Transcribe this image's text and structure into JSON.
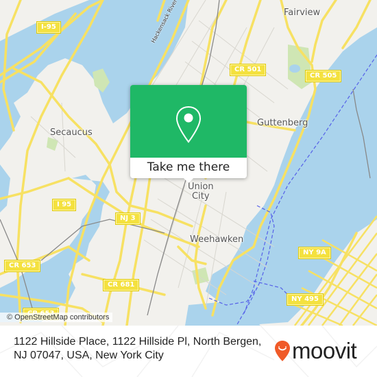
{
  "map": {
    "place_labels": [
      {
        "id": "fairview",
        "text": "Fairview"
      },
      {
        "id": "secaucus",
        "text": "Secaucus"
      },
      {
        "id": "guttenberg",
        "text": "Guttenberg"
      },
      {
        "id": "union-city",
        "text": "Union\nCity"
      },
      {
        "id": "weehawken",
        "text": "Weehawken"
      }
    ],
    "river_label": "Hackensack River",
    "route_shields": [
      {
        "id": "i-95-north",
        "text": "I-95"
      },
      {
        "id": "cr-501",
        "text": "CR 501"
      },
      {
        "id": "cr-505",
        "text": "CR 505"
      },
      {
        "id": "i-95-south",
        "text": "I 95"
      },
      {
        "id": "nj-3",
        "text": "NJ 3"
      },
      {
        "id": "cr-653-a",
        "text": "CR 653"
      },
      {
        "id": "ny-9a",
        "text": "NY 9A"
      },
      {
        "id": "cr-681",
        "text": "CR 681"
      },
      {
        "id": "ny-495",
        "text": "NY 495"
      },
      {
        "id": "cr-653-b",
        "text": "CR 653"
      }
    ],
    "attribution": "© OpenStreetMap contributors",
    "colors": {
      "water": "#aad3ec",
      "land": "#f2f1ed",
      "road": "#f7e163",
      "park": "#cfe6b4",
      "ferry": "#5560e8"
    }
  },
  "popup": {
    "button_label": "Take me there",
    "pin_icon": "map-pin-icon",
    "color": "#1fb866"
  },
  "footer": {
    "address_line": "1122 Hillside Place, 1122 Hillside Pl, North Bergen, NJ 07047, USA, New York City",
    "brand": "moovit",
    "brand_color": "#f05a28"
  }
}
